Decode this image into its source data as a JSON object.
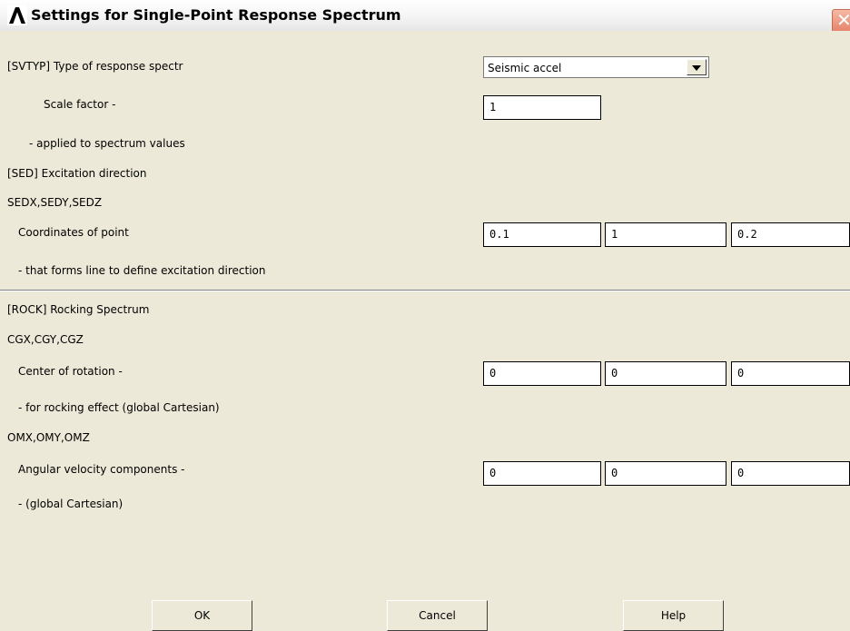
{
  "window": {
    "title": "Settings for Single-Point Response Spectrum",
    "close_glyph": "✕"
  },
  "svtyp": {
    "label": "[SVTYP]  Type of response spectr",
    "selected": "Seismic accel",
    "scale_label": "Scale factor -",
    "scale_value": "1",
    "scale_note": "- applied to spectrum values"
  },
  "sed": {
    "label": "[SED]   Excitation direction",
    "vars": "SEDX,SEDY,SEDZ",
    "coord_label": "Coordinates of point",
    "x": "0.1",
    "y": "1",
    "z": "0.2",
    "note": "- that forms line to define excitation direction"
  },
  "rock": {
    "label": "[ROCK]  Rocking Spectrum",
    "cg_vars": "CGX,CGY,CGZ",
    "center_label": "Center of rotation -",
    "cgx": "0",
    "cgy": "0",
    "cgz": "0",
    "center_note": "- for rocking effect (global Cartesian)",
    "om_vars": "OMX,OMY,OMZ",
    "omega_label": "Angular velocity components -",
    "omx": "0",
    "omy": "0",
    "omz": "0",
    "omega_note": "- (global Cartesian)"
  },
  "buttons": {
    "ok": "OK",
    "cancel": "Cancel",
    "help": "Help"
  },
  "colors": {
    "background": "#ece9d8",
    "field": "#ffffff",
    "close_button": "#e6826a"
  },
  "icons": [
    "ansys-logo-icon",
    "close-icon",
    "dropdown-arrow-icon"
  ]
}
